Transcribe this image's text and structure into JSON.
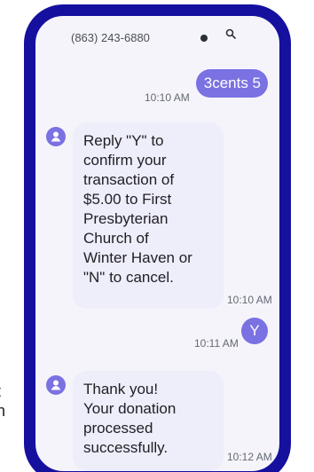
{
  "conversation": {
    "contact_phone": "(863) 243-6880",
    "messages": [
      {
        "direction": "outgoing",
        "text": "3cents 5",
        "time": "10:10 AM"
      },
      {
        "direction": "incoming",
        "lines": [
          "Reply \"Y\" to",
          "confirm your",
          "transaction of",
          "$5.00 to First",
          "Presbyterian",
          "Church of",
          "Winter Haven or",
          "\"N\" to cancel."
        ],
        "time": "10:10 AM"
      },
      {
        "direction": "outgoing",
        "text": "Y",
        "time": "10:11 AM"
      },
      {
        "direction": "incoming",
        "lines": [
          "Thank you!",
          "Your donation",
          "processed",
          "successfully."
        ],
        "time": "10:12 AM"
      }
    ]
  },
  "background_text": {
    "line1": "t",
    "line2": "n"
  },
  "colors": {
    "phone_frame": "#15109e",
    "outgoing_bubble": "#7a71e2",
    "incoming_bubble": "#eeedfa",
    "screen_background": "#f5f4fb"
  },
  "icons": {
    "avatar": "person-icon",
    "status": "search-icon"
  }
}
